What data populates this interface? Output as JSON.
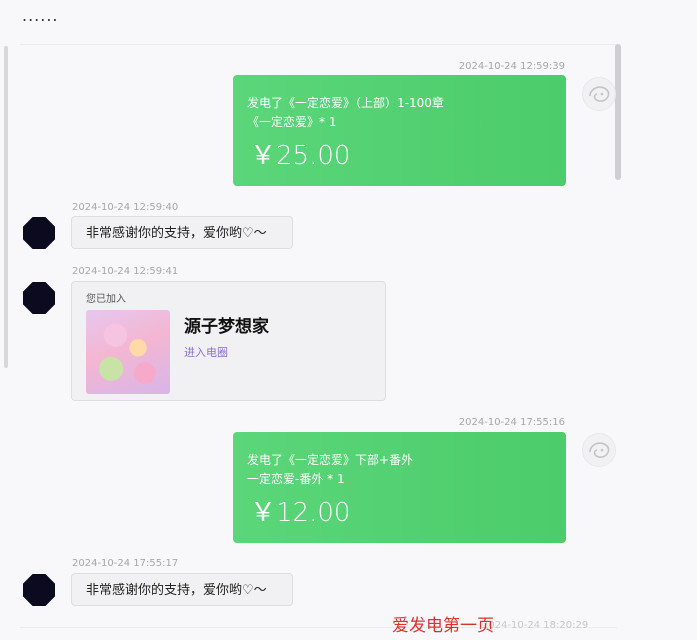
{
  "header": {
    "dots": "......"
  },
  "messages": [
    {
      "timestamp": "2024-10-24 12:59:39",
      "line1": "发电了《一定恋爱》（上部）1-100章",
      "line2": "《一定恋爱》* 1",
      "amount": "￥25.00"
    },
    {
      "timestamp": "2024-10-24 12:59:40",
      "text": "非常感谢你的支持，爱你哟♡～"
    },
    {
      "timestamp": "2024-10-24 12:59:41",
      "joined_label": "您已加入",
      "group_name": "源子梦想家",
      "enter_label": "进入电圈"
    },
    {
      "timestamp": "2024-10-24 17:55:16",
      "line1": "发电了《一定恋爱》下部+番外",
      "line2": "一定恋爱-番外 * 1",
      "amount": "￥12.00"
    },
    {
      "timestamp": "2024-10-24 17:55:17",
      "text": "非常感谢你的支持，爱你哟♡～"
    }
  ],
  "footer": {
    "watermark": "爱发电第一页",
    "partial_timestamp": "2024-10-24 18:20:29"
  },
  "colors": {
    "green_start": "#5bd67a",
    "green_end": "#4ccc6a",
    "watermark": "#e0302c",
    "link": "#8b6fd2"
  }
}
